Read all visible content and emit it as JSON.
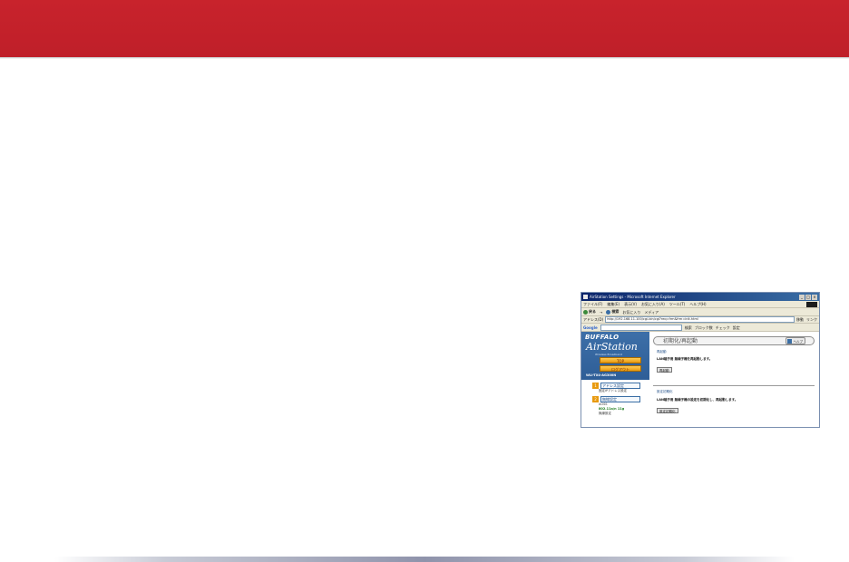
{
  "colors": {
    "banner": "#c8232c",
    "footer": "#8f93ab"
  },
  "window": {
    "title": "AirStation Settings - Microsoft Internet Explorer",
    "buttons": [
      "_",
      "□",
      "×"
    ],
    "menu": [
      "ファイル(F)",
      "編集(E)",
      "表示(V)",
      "お気に入り(A)",
      "ツール(T)",
      "ヘルプ(H)"
    ],
    "toolbar": [
      "戻る",
      "→",
      "検索",
      "お気に入り",
      "メディア"
    ],
    "address_label": "アドレス(D)",
    "address": "http://192.168.11.100/cgi-bin/cgi?req=frm&frm=init.html",
    "go_label": "移動",
    "links_label": "リンク",
    "google_label": "Google",
    "google_items": [
      "検索",
      "ブロック数",
      "チェック",
      "設定"
    ]
  },
  "airstation": {
    "brand": "BUFFALO",
    "product": "AirStation",
    "tagline": "Wireless Broadband",
    "top_button": "TOP",
    "logout_button": "ログアウト",
    "model": "WLI-TX4-AG300N",
    "nav": [
      {
        "num": "1",
        "label": "アドレス設定",
        "sub": "固定IPアドレス設定"
      },
      {
        "num": "2",
        "label": "無線設定",
        "sub": "AOSS"
      }
    ],
    "nav_link": "802.11a/n 11g",
    "nav_extra": "無線設定"
  },
  "page": {
    "header": "初期化/再起動",
    "help": "ヘルプ",
    "section1_title": "再起動",
    "section1_text": "LAN端子用 無線子機を再起動します。",
    "section1_button": "再起動",
    "section2_title": "設定初期化",
    "section2_text": "LAN端子用 無線子機の設定を初期化し、再起動します。",
    "section2_button": "設定初期化"
  }
}
